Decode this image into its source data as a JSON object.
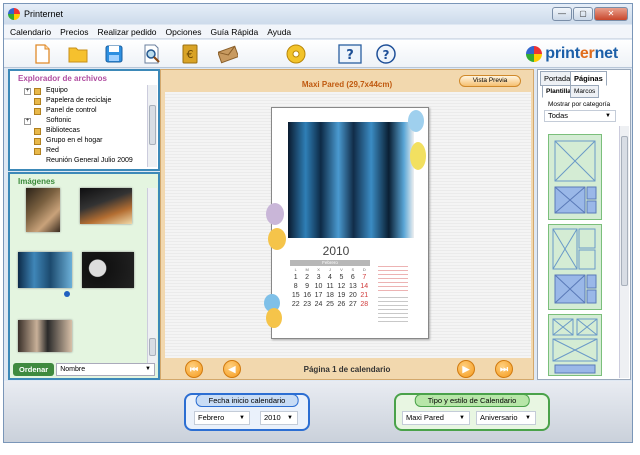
{
  "window": {
    "title": "Printernet",
    "btn_min": "—",
    "btn_max": "▢",
    "btn_close": "✕"
  },
  "menu": [
    "Calendario",
    "Precios",
    "Realizar pedido",
    "Opciones",
    "Guía Rápida",
    "Ayuda"
  ],
  "logo": {
    "part1": "print",
    "part2": "er",
    "part3": "net"
  },
  "explorer": {
    "title": "Explorador de archivos",
    "items": [
      "Equipo",
      "Papelera de reciclaje",
      "Panel de control",
      "Softonic",
      "Bibliotecas",
      "Grupo en el hogar",
      "Red",
      "Reunión General Julio 2009"
    ]
  },
  "images": {
    "title": "Imágenes",
    "order_label": "Ordenar",
    "order_value": "Nombre"
  },
  "center": {
    "product_title": "Maxi Pared (29,7x44cm)",
    "preview_button": "Vista Previa",
    "page_label": "Página 1 de calendario",
    "calendar_year": "2010",
    "month_name": "Febrero",
    "weekdays": [
      "L",
      "M",
      "X",
      "J",
      "V",
      "S",
      "D"
    ],
    "weeks": [
      [
        "1",
        "2",
        "3",
        "4",
        "5",
        "6",
        "7"
      ],
      [
        "8",
        "9",
        "10",
        "11",
        "12",
        "13",
        "14"
      ],
      [
        "15",
        "16",
        "17",
        "18",
        "19",
        "20",
        "21"
      ],
      [
        "22",
        "23",
        "24",
        "25",
        "26",
        "27",
        "28"
      ]
    ]
  },
  "right": {
    "tabs": [
      "Portada",
      "Páginas"
    ],
    "subtabs": [
      "Plantillas",
      "Marcos"
    ],
    "category_label": "Mostrar por categoría",
    "category_value": "Todas"
  },
  "bottom": {
    "start_group": {
      "label": "Fecha inicio calendario",
      "month": "Febrero",
      "year": "2010"
    },
    "style_group": {
      "label": "Tipo y estilo de Calendario",
      "type": "Maxi Pared",
      "style": "Aniversario"
    }
  },
  "colors": {
    "accent_orange": "#e07020",
    "pane_blue": "#3d89b8",
    "green": "#4aa24a"
  }
}
